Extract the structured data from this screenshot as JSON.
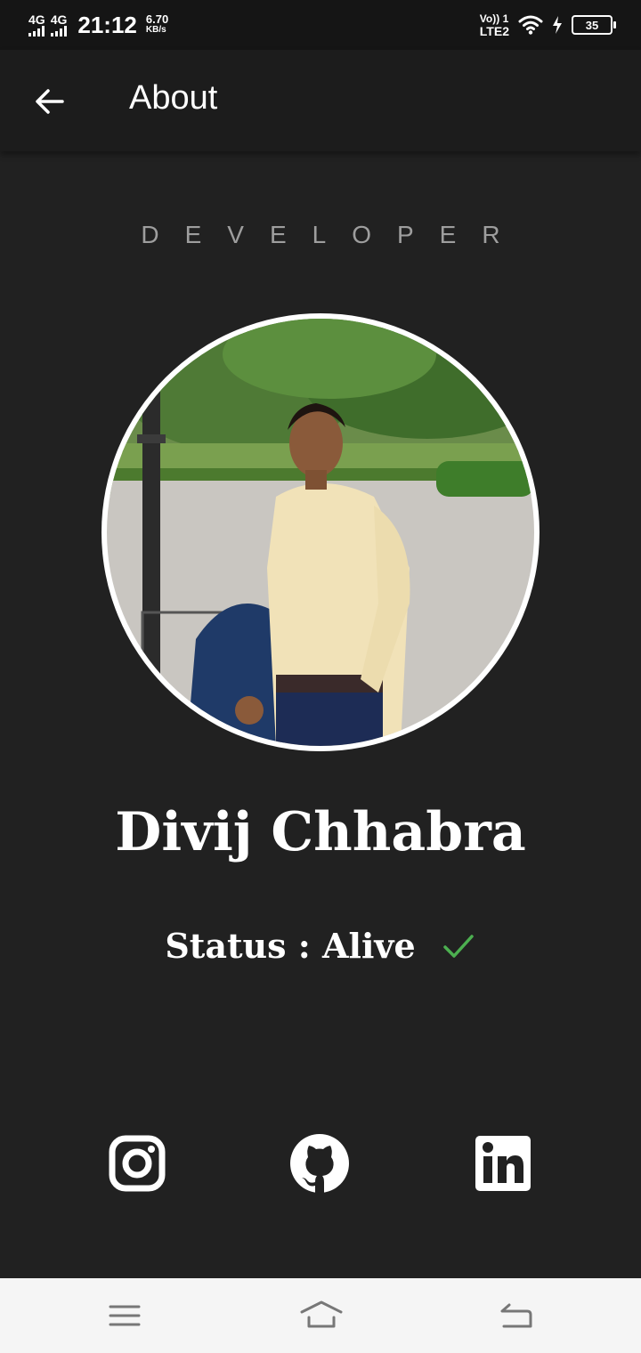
{
  "status_bar": {
    "network1": "4G",
    "network2": "4G",
    "time": "21:12",
    "speed_value": "6.70",
    "speed_unit": "KB/s",
    "volte_line1": "Vo)) 1",
    "volte_line2": "LTE2",
    "battery": "35"
  },
  "app_bar": {
    "title": "About"
  },
  "profile": {
    "role": "DEVELOPER",
    "name": "Divij Chhabra",
    "status": "Status : Alive"
  },
  "icons": {
    "back": "arrow-left-icon",
    "check": "check-icon",
    "instagram": "instagram-icon",
    "github": "github-icon",
    "linkedin": "linkedin-icon",
    "nav_menu": "menu-icon",
    "nav_home": "home-icon",
    "nav_back": "return-icon"
  },
  "colors": {
    "background": "#212121",
    "app_bar": "#1c1c1c",
    "role_text": "#9e9e9e",
    "check": "#4caf50",
    "nav_bar": "#f5f5f5"
  }
}
